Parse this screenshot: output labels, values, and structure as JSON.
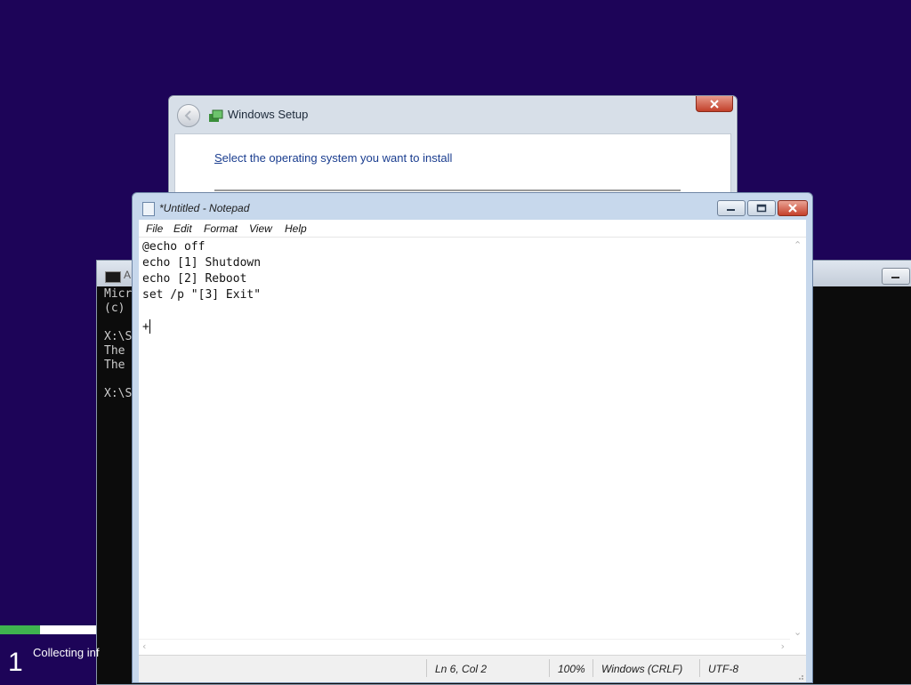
{
  "setup": {
    "title": "Windows Setup",
    "prompt": "elect the operating system you want to install",
    "prompt_underlined_letter": "S"
  },
  "cmd": {
    "title": "A",
    "lines": [
      "Micr",
      "(c)",
      "",
      "X:\\S",
      "The",
      "The",
      "",
      "X:\\S"
    ]
  },
  "install_progress": {
    "step_number": "1",
    "step_label": "Collecting inf",
    "progress_fraction": 0.42,
    "fill_color": "#3fb34f"
  },
  "notepad": {
    "title": "*Untitled - Notepad",
    "menu": [
      "File",
      "Edit",
      "Format",
      "View",
      "Help"
    ],
    "content": "@echo off\necho [1] Shutdown\necho [2] Reboot\nset /p \"[3] Exit\"\n\n+",
    "status": {
      "position": "Ln 6, Col 2",
      "zoom": "100%",
      "line_ending": "Windows (CRLF)",
      "encoding": "UTF-8"
    }
  },
  "colors": {
    "desktop_background": "#1d0458",
    "close_button": "#c5412b",
    "titlebar": "#c7d8ec"
  }
}
